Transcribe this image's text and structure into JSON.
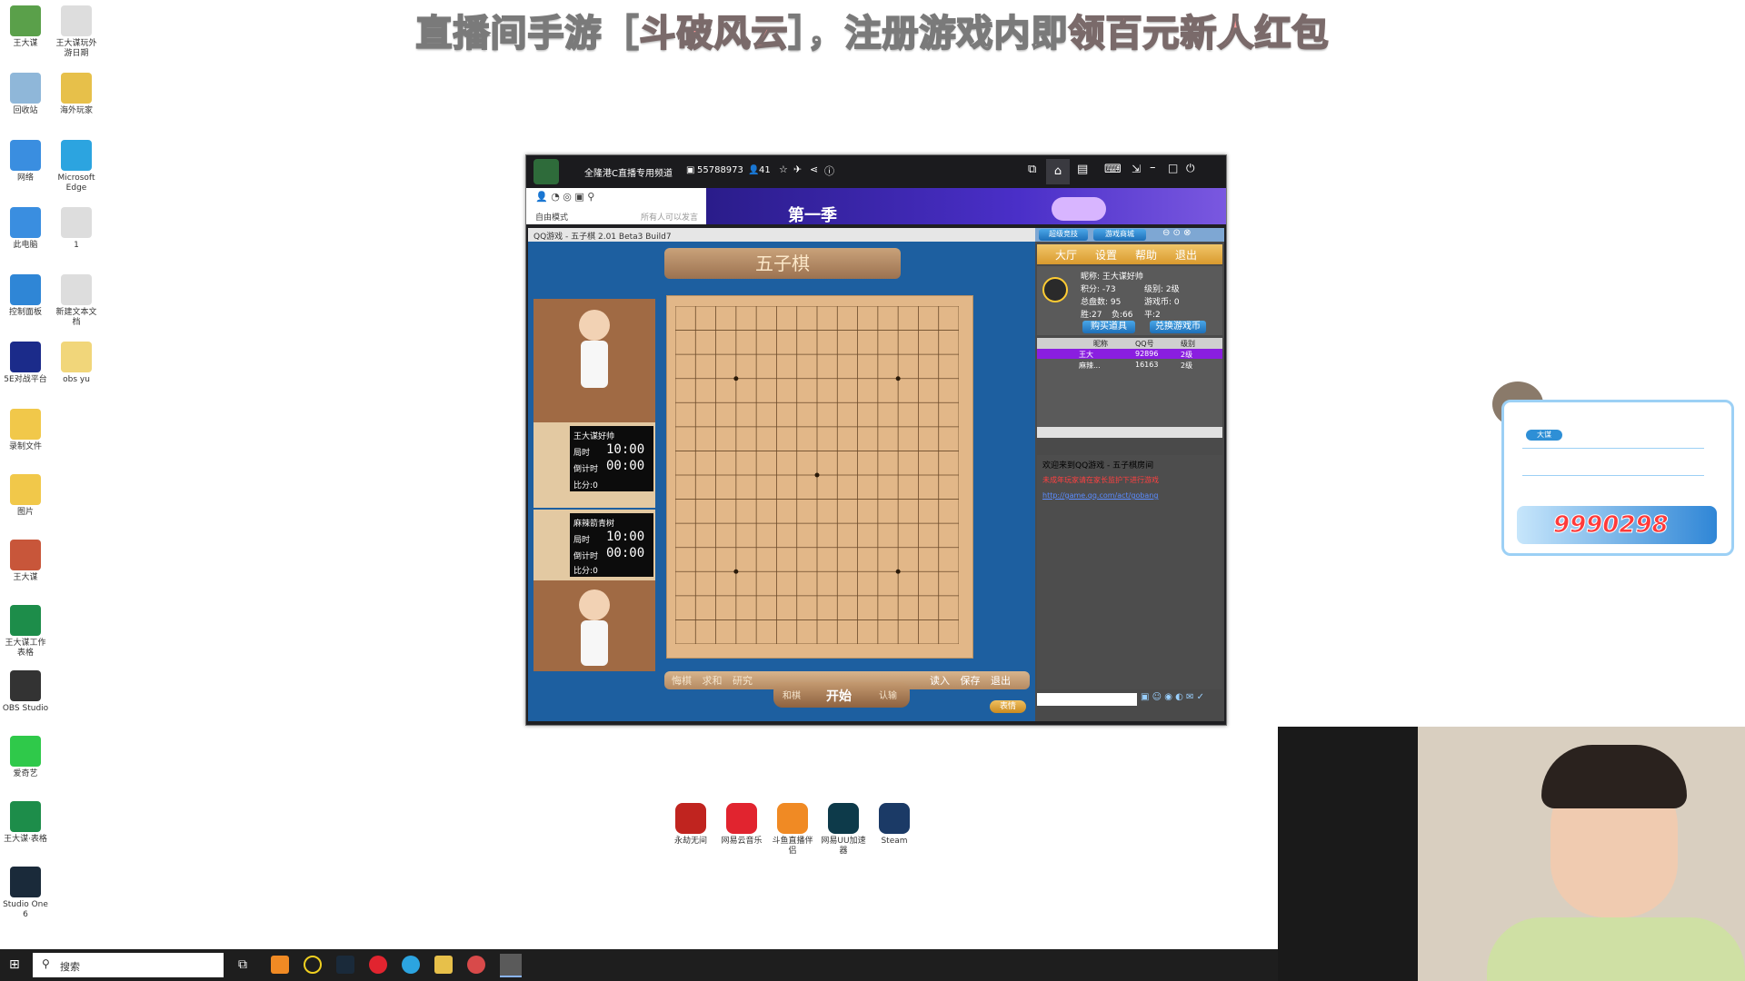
{
  "banner": {
    "part1": "直播间手游［",
    "part2": "斗破风云",
    "part3": "］，注册游戏内即",
    "part4": "领百元新人红包"
  },
  "desktop_icons": [
    {
      "label": "王大谋",
      "color": "#5aa04a"
    },
    {
      "label": "王大谋玩外\n游日期",
      "color": "#dddddd"
    },
    {
      "label": "回收站",
      "color": "#8fb7d9"
    },
    {
      "label": "海外玩家",
      "color": "#e7c04a"
    },
    {
      "label": "网络",
      "color": "#3a8ee0"
    },
    {
      "label": "Microsoft\nEdge",
      "color": "#2ca4e0"
    },
    {
      "label": "此电脑",
      "color": "#3a8ee0"
    },
    {
      "label": "1",
      "color": "#dddddd"
    },
    {
      "label": "控制面板",
      "color": "#2f86d6"
    },
    {
      "label": "新建文本文\n档",
      "color": "#dddddd"
    },
    {
      "label": "5E对战平台",
      "color": "#1b2b8a"
    },
    {
      "label": "obs yu",
      "color": "#f1d67a"
    },
    {
      "label": "录制文件",
      "color": "#f1c84a"
    },
    {
      "label": "图片",
      "color": "#f1c84a"
    },
    {
      "label": "王大谋",
      "color": "#c8563a"
    },
    {
      "label": "王大谋工作\n表格",
      "color": "#1d8d4a"
    },
    {
      "label": "OBS Studio",
      "color": "#333333"
    },
    {
      "label": "爱奇艺",
      "color": "#2fc94a"
    },
    {
      "label": "王大谋·表格",
      "color": "#1d8d4a"
    },
    {
      "label": "Studio One\n6",
      "color": "#1a2a3a"
    }
  ],
  "window": {
    "title": "全隆港C直播专用频道",
    "room_id": "55788973",
    "viewers": "41",
    "mode": "自由模式",
    "mode_hint": "所有人可以发言",
    "season": "第一季"
  },
  "game": {
    "title_bar": "QQ游戏 - 五子棋  2.01 Beta3 Build7",
    "banner_title": "五子棋",
    "player1": {
      "name": "王大谋好帅",
      "time_label": "局时",
      "time": "10:00",
      "countdown_label": "倒计时",
      "countdown": "00:00",
      "score_label": "比分",
      "score": "0"
    },
    "player2": {
      "name": "麻辣箭青树",
      "time_label": "局时",
      "time": "10:00",
      "countdown_label": "倒计时",
      "countdown": "00:00",
      "score_label": "比分",
      "score": "0"
    },
    "actions_left": [
      "悔棋",
      "求和",
      "研究"
    ],
    "actions_mid": [
      "和棋",
      "开始",
      "认输"
    ],
    "actions_right": [
      "读入",
      "保存",
      "退出"
    ],
    "small_button": "表情"
  },
  "side": {
    "tabs": [
      "超级竞技",
      "游戏商城"
    ],
    "menu": [
      "大厅",
      "设置",
      "帮助",
      "退出"
    ],
    "info": {
      "nickname": "昵称: 王大谋好帅",
      "points": "积分: -73",
      "level": "级别: 2级",
      "games": "总盘数: 95",
      "coins": "游戏币: 0",
      "wins": "胜:27",
      "losses": "负:66",
      "draws": "平:2"
    },
    "buy_button": "购买道具",
    "exchange_button": "兑换游戏币",
    "list_headers": [
      "昵称",
      "QQ号",
      "级别"
    ],
    "players": [
      {
        "name": "王大",
        "qq": "92896",
        "level": "2级"
      },
      {
        "name": "麻辣...",
        "qq": "16163",
        "level": "2级"
      }
    ],
    "chat": [
      {
        "text": "欢迎来到QQ游戏 - 五子棋房间",
        "color": "#e0e0ff"
      },
      {
        "text": "未成年玩家请在家长监护下进行游戏",
        "color": "#ff4040"
      },
      {
        "text": "http://game.qq.com/act/gobang",
        "color": "#5a8cff"
      }
    ]
  },
  "overlay": {
    "tag": "大谋",
    "number": "9990298"
  },
  "dock": [
    {
      "label": "永劫无间",
      "color": "#c0241f"
    },
    {
      "label": "网易云音乐",
      "color": "#e1242f"
    },
    {
      "label": "斗鱼直播伴\n侣",
      "color": "#f08a24"
    },
    {
      "label": "网易UU加速\n器",
      "color": "#0d3a4a"
    },
    {
      "label": "Steam",
      "color": "#1b3a66"
    }
  ],
  "taskbar": {
    "search": "搜索"
  }
}
